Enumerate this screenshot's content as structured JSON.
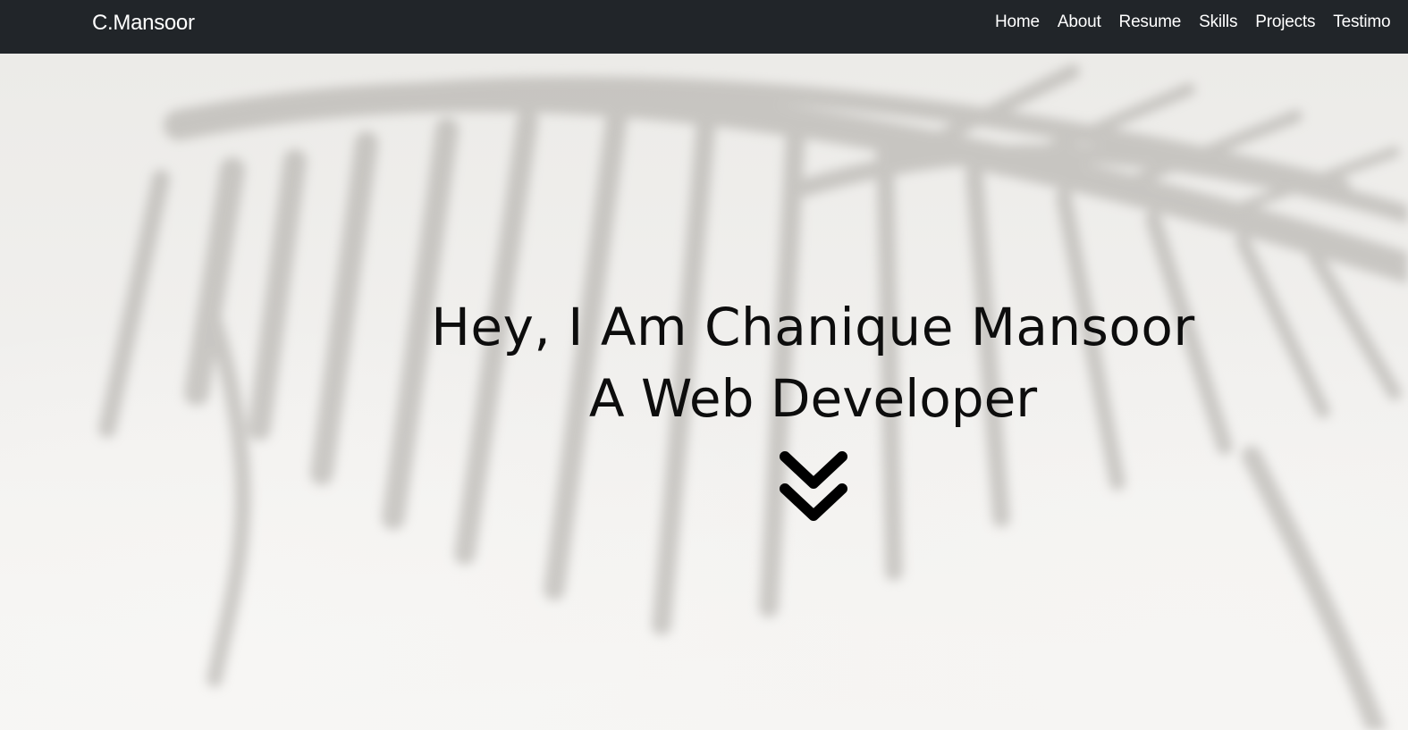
{
  "navbar": {
    "brand": "C.Mansoor",
    "links": [
      "Home",
      "About",
      "Resume",
      "Skills",
      "Projects",
      "Testimo"
    ]
  },
  "hero": {
    "line1": "Hey, I Am Chanique Mansoor",
    "line2": "A Web Developer",
    "scroll_icon": "double-chevron-down-icon"
  },
  "colors": {
    "navbar_bg": "#212529",
    "nav_text": "#ffffff",
    "hero_text": "#0d0d0d"
  }
}
